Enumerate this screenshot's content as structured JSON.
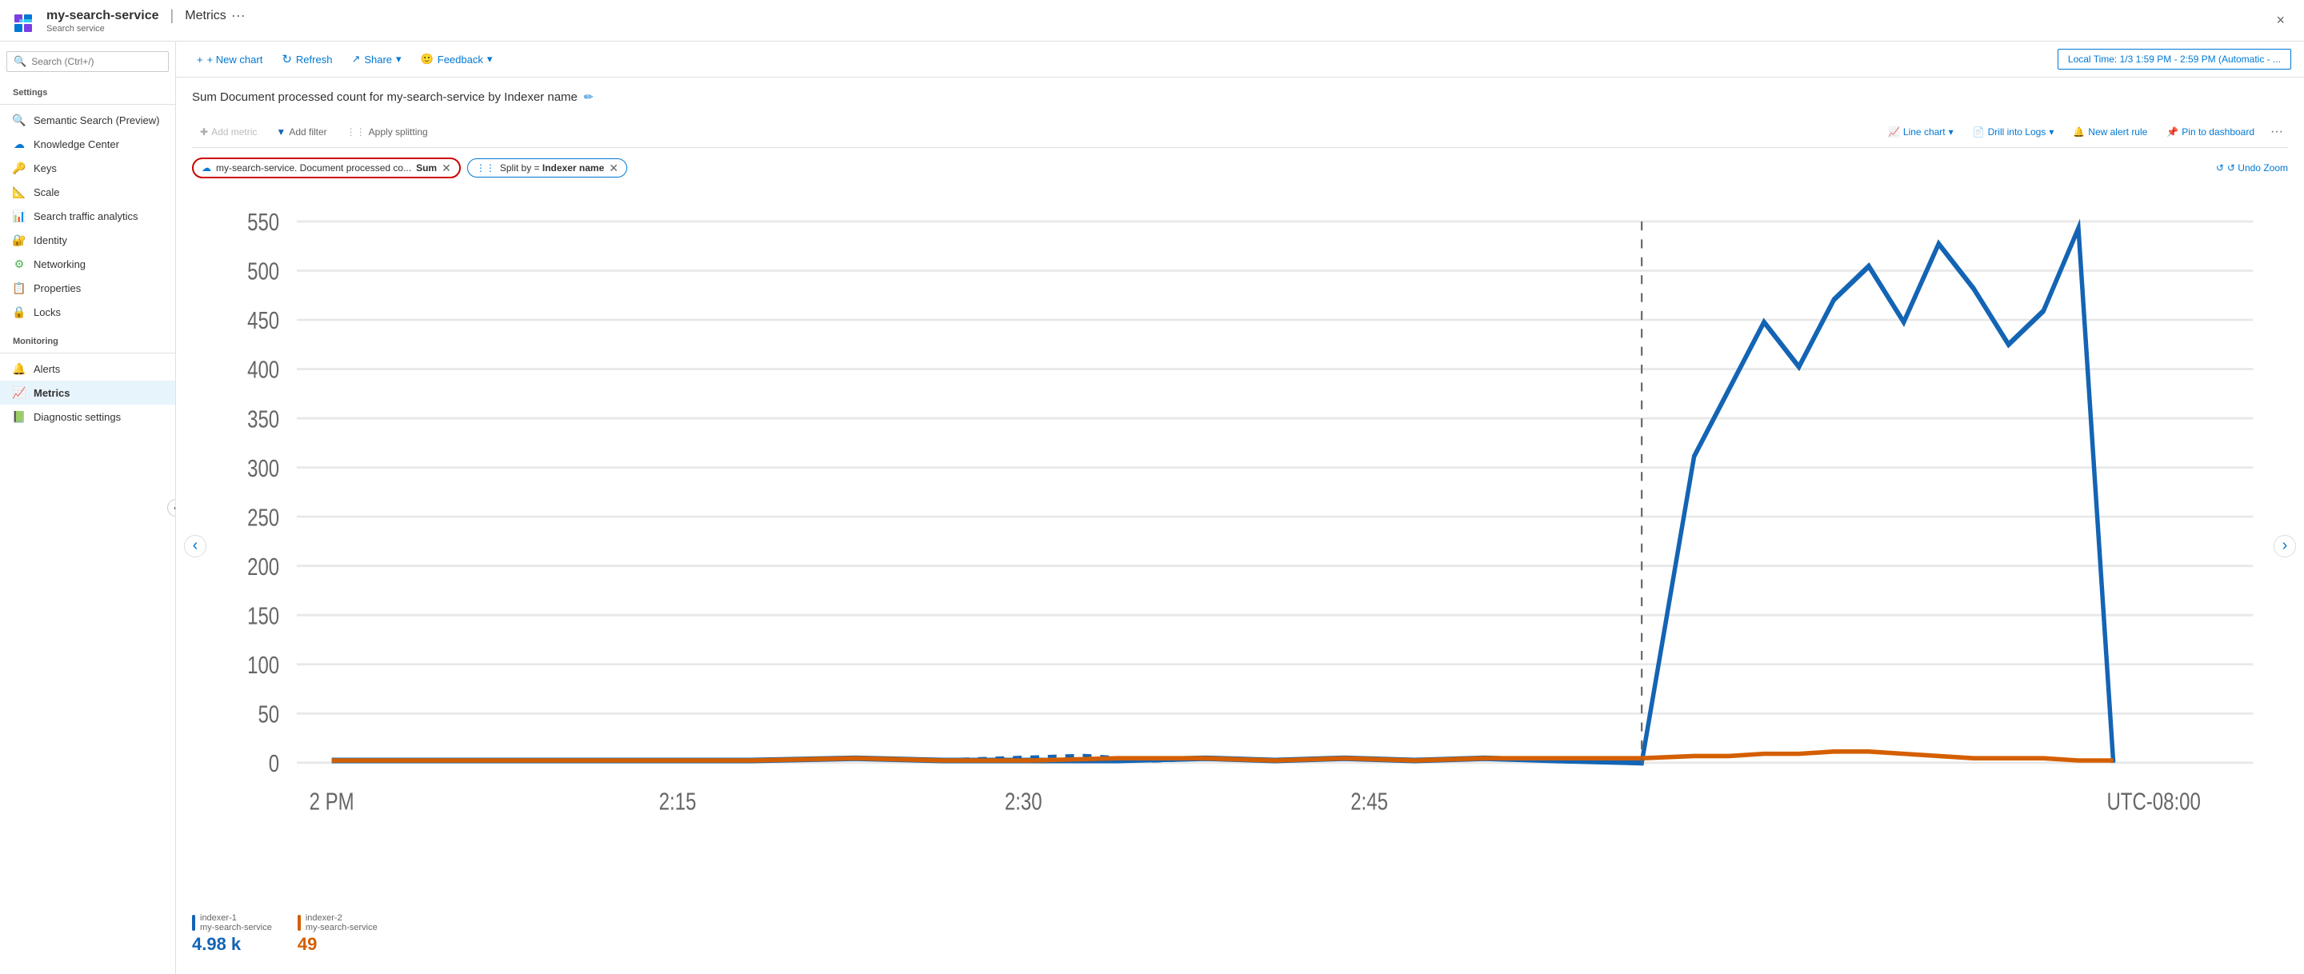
{
  "titleBar": {
    "serviceName": "my-search-service",
    "separator": "|",
    "pageTitle": "Metrics",
    "moreIcon": "···",
    "subtitle": "Search service",
    "closeLabel": "×"
  },
  "sidebar": {
    "searchPlaceholder": "Search (Ctrl+/)",
    "collapseIcon": "«",
    "sections": [
      {
        "label": "Settings",
        "items": [
          {
            "id": "semantic-search",
            "label": "Semantic Search (Preview)",
            "icon": "🔍",
            "color": "#0078d4"
          },
          {
            "id": "knowledge-center",
            "label": "Knowledge Center",
            "icon": "☁",
            "color": "#0078d4"
          },
          {
            "id": "keys",
            "label": "Keys",
            "icon": "🔑",
            "color": "#f0a800"
          },
          {
            "id": "scale",
            "label": "Scale",
            "icon": "📐",
            "color": "#0078d4"
          },
          {
            "id": "search-traffic",
            "label": "Search traffic analytics",
            "icon": "📊",
            "color": "#0078d4"
          },
          {
            "id": "identity",
            "label": "Identity",
            "icon": "🔐",
            "color": "#f0a800"
          },
          {
            "id": "networking",
            "label": "Networking",
            "icon": "⚙",
            "color": "#4caf50"
          },
          {
            "id": "properties",
            "label": "Properties",
            "icon": "📋",
            "color": "#0078d4"
          },
          {
            "id": "locks",
            "label": "Locks",
            "icon": "🔒",
            "color": "#666"
          }
        ]
      },
      {
        "label": "Monitoring",
        "items": [
          {
            "id": "alerts",
            "label": "Alerts",
            "icon": "🔔",
            "color": "#4caf50"
          },
          {
            "id": "metrics",
            "label": "Metrics",
            "icon": "📈",
            "color": "#0078d4",
            "active": true
          },
          {
            "id": "diagnostic-settings",
            "label": "Diagnostic settings",
            "icon": "📗",
            "color": "#4caf50"
          }
        ]
      }
    ]
  },
  "toolbar": {
    "newChartLabel": "+ New chart",
    "refreshLabel": "↻ Refresh",
    "shareLabel": "↗ Share",
    "shareDropdown": "▾",
    "feedbackLabel": "🙂 Feedback",
    "feedbackDropdown": "▾",
    "timeRangeLabel": "Local Time: 1/3 1:59 PM - 2:59 PM (Automatic - ..."
  },
  "chart": {
    "title": "Sum Document processed count for my-search-service by Indexer name",
    "editIcon": "✏",
    "metricsToolbar": {
      "addMetricLabel": "Add metric",
      "addFilterLabel": "Add filter",
      "applySplittingLabel": "Apply splitting",
      "lineChartLabel": "Line chart",
      "lineChartDropdown": "▾",
      "drillIntoLogsLabel": "Drill into Logs",
      "drillDropdown": "▾",
      "newAlertRuleLabel": "New alert rule",
      "pinToDashboardLabel": "Pin to dashboard",
      "moreLabel": "···"
    },
    "pills": [
      {
        "id": "metric-pill",
        "icon": "☁",
        "text": "my-search-service. Document processed co...",
        "badge": "Sum",
        "highlighted": true
      },
      {
        "id": "split-pill",
        "icon": "⋮⋮",
        "text": "Split by = Indexer name",
        "highlighted": false
      }
    ],
    "undoZoomLabel": "↺ Undo Zoom",
    "yAxis": [
      "550",
      "500",
      "450",
      "400",
      "350",
      "300",
      "250",
      "200",
      "150",
      "100",
      "50",
      "0"
    ],
    "xAxis": [
      "2 PM",
      "",
      "2:15",
      "",
      "2:30",
      "",
      "2:45",
      "",
      "UTC-08:00"
    ],
    "legend": [
      {
        "id": "indexer-1",
        "colorHex": "#1464b4",
        "name1": "indexer-1",
        "name2": "my-search-service",
        "value": "4.98 k"
      },
      {
        "id": "indexer-2",
        "colorHex": "#d45f00",
        "name1": "indexer-2",
        "name2": "my-search-service",
        "value": "49"
      }
    ]
  }
}
